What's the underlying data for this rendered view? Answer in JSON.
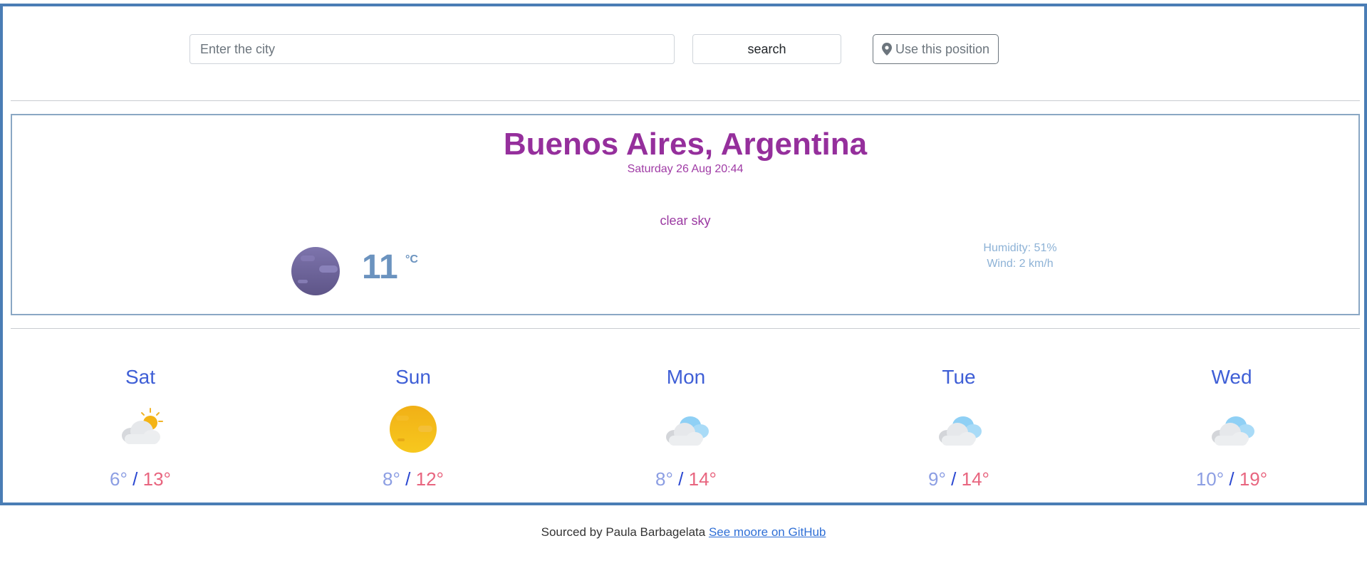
{
  "search": {
    "placeholder": "Enter the city",
    "button_label": "search",
    "position_label": "Use this position"
  },
  "current": {
    "city": "Buenos Aires, Argentina",
    "date": "Saturday 26 Aug 20:44",
    "description": "clear sky",
    "temperature": "11",
    "unit": "°C",
    "icon": "moon-icon",
    "humidity": "Humidity: 51%",
    "wind": "Wind: 2 km/h"
  },
  "forecast": [
    {
      "day": "Sat",
      "icon": "partly-cloudy-sun-icon",
      "min": "6°",
      "sep": "/",
      "max": "13°"
    },
    {
      "day": "Sun",
      "icon": "sun-icon",
      "min": "8°",
      "sep": "/",
      "max": "12°"
    },
    {
      "day": "Mon",
      "icon": "cloudy-icon",
      "min": "8°",
      "sep": "/",
      "max": "14°"
    },
    {
      "day": "Tue",
      "icon": "cloudy-icon",
      "min": "9°",
      "sep": "/",
      "max": "14°"
    },
    {
      "day": "Wed",
      "icon": "cloudy-icon",
      "min": "10°",
      "sep": "/",
      "max": "19°"
    }
  ],
  "footer": {
    "text": "Sourced by Paula Barbagelata",
    "link_text": "See moore on GitHub"
  },
  "colors": {
    "frame": "#4a7db5",
    "title": "#952f9c",
    "day_name": "#3f5fd6",
    "min_temp": "#8c9ee3",
    "max_temp": "#e8657f"
  }
}
